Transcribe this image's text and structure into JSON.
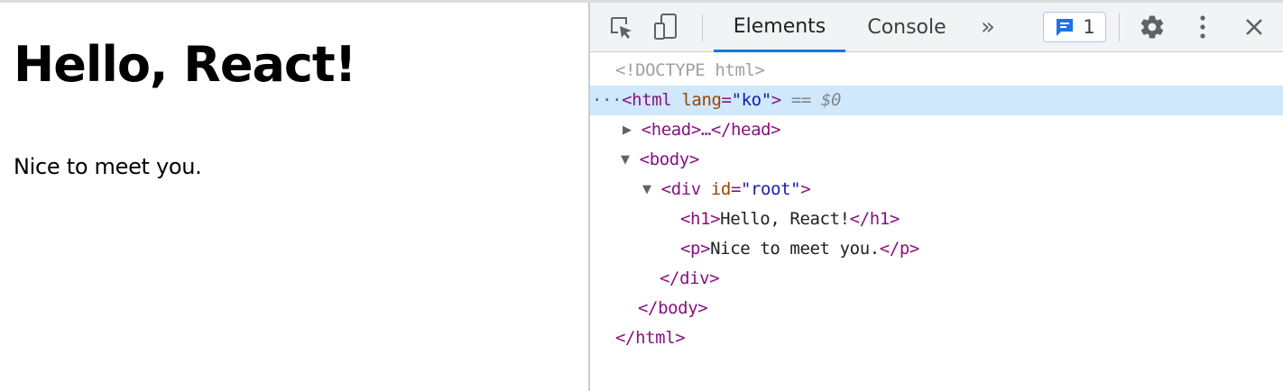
{
  "page": {
    "heading": "Hello, React!",
    "paragraph": "Nice to meet you."
  },
  "devtools": {
    "tabs": [
      {
        "label": "Elements",
        "active": true
      },
      {
        "label": "Console",
        "active": false
      }
    ],
    "more_tabs": "»",
    "issues_count": "1",
    "icons": {
      "inspect": "inspect-element-icon",
      "device": "device-toolbar-icon",
      "issues": "issues-message-icon",
      "settings": "gear-icon",
      "menu": "kebab-menu-icon",
      "close": "close-icon"
    },
    "colors": {
      "accent": "#1a73e8",
      "selected_row": "#cfe8fc",
      "tag": "#881280",
      "attr": "#994500",
      "value": "#1a1aa6"
    },
    "dom": {
      "doctype": "<!DOCTYPE html>",
      "html_open": "<html",
      "lang_attr": "lang",
      "lang_eq": "=",
      "lang_val": "\"ko\"",
      "html_close_bracket": ">",
      "selected_marker": "== $0",
      "head_collapsed": "<head>…</head>",
      "body_open": "<body>",
      "div_open": "<div",
      "id_attr": "id",
      "id_eq": "=",
      "id_val": "\"root\"",
      "div_close_bracket": ">",
      "h1_open": "<h1>",
      "h1_text": "Hello, React!",
      "h1_close": "</h1>",
      "p_open": "<p>",
      "p_text": "Nice to meet you.",
      "p_close": "</p>",
      "div_close": "</div>",
      "body_close": "</body>",
      "html_close": "</html>",
      "dots": "···"
    }
  }
}
